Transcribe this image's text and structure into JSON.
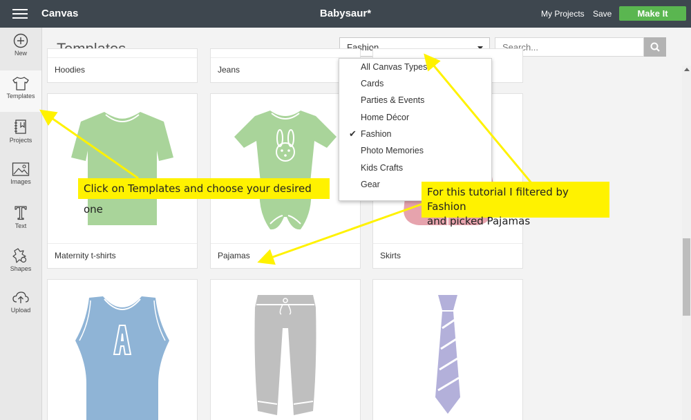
{
  "topbar": {
    "app_name": "Canvas",
    "doc_title": "Babysaur*",
    "my_projects": "My Projects",
    "save": "Save",
    "make_it": "Make It"
  },
  "sidebar": {
    "items": [
      {
        "label": "New",
        "icon": "plus-circle-icon"
      },
      {
        "label": "Templates",
        "icon": "tshirt-icon",
        "active": true
      },
      {
        "label": "Projects",
        "icon": "projects-icon"
      },
      {
        "label": "Images",
        "icon": "image-icon"
      },
      {
        "label": "Text",
        "icon": "text-icon"
      },
      {
        "label": "Shapes",
        "icon": "shapes-icon"
      },
      {
        "label": "Upload",
        "icon": "upload-cloud-icon"
      }
    ]
  },
  "main": {
    "title": "Templates",
    "filter": {
      "selected": "Fashion"
    },
    "search": {
      "placeholder": "Search..."
    },
    "cards": [
      {
        "caption": "Hoodies"
      },
      {
        "caption": "Jeans"
      },
      {
        "caption": "Maternity t-shirts",
        "image": "green-tshirt"
      },
      {
        "caption": "Pajamas",
        "image": "green-bunny-onesie"
      },
      {
        "caption": "Skirts",
        "image": "pink-skirt"
      },
      {
        "caption": "",
        "image": "blue-tank-top"
      },
      {
        "caption": "",
        "image": "gray-pants"
      },
      {
        "caption": "",
        "image": "purple-tie"
      }
    ]
  },
  "dropdown": {
    "items": [
      {
        "label": "All Canvas Types",
        "checked": false
      },
      {
        "label": "Cards",
        "checked": false
      },
      {
        "label": "Parties & Events",
        "checked": false
      },
      {
        "label": "Home Décor",
        "checked": false
      },
      {
        "label": "Fashion",
        "checked": true,
        "check_mark": "✔"
      },
      {
        "label": "Photo Memories",
        "checked": false
      },
      {
        "label": "Kids Crafts",
        "checked": false
      },
      {
        "label": "Gear",
        "checked": false
      }
    ]
  },
  "annotations": {
    "note1": "Click on Templates and choose your desired one",
    "note2_line1": "For this tutorial I filtered by Fashion",
    "note2_line2": "and picked Pajamas",
    "color": "#fff200"
  },
  "colors": {
    "topbar": "#3e474f",
    "make_it": "#5ab650",
    "shirt_green": "#a9d49a",
    "tank_blue": "#8fb4d6",
    "pants_gray": "#bfbfbf",
    "tie_purple": "#b3b0da",
    "skirt_pink": "#e6a3ad"
  }
}
